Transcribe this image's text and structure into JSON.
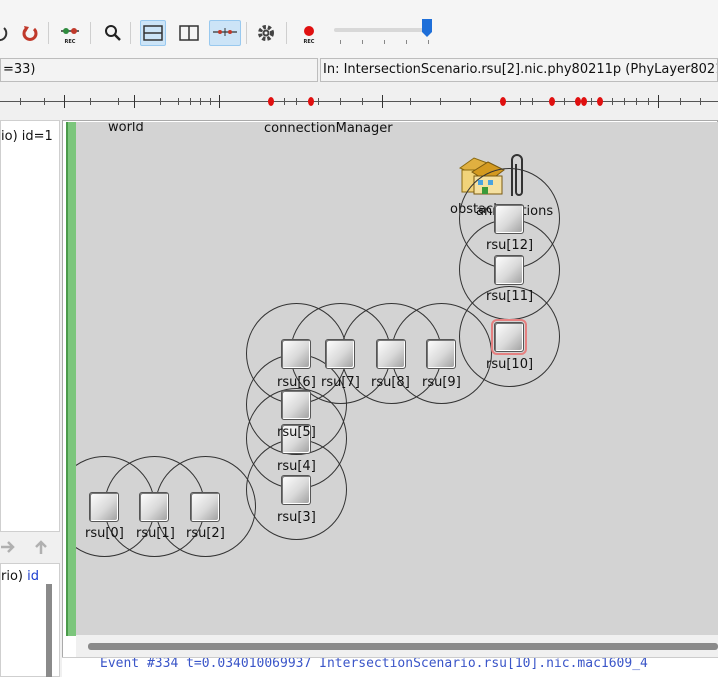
{
  "toolbar": {
    "buttons": [
      {
        "icon": "rebuild-network-icon"
      },
      {
        "icon": "restart-icon"
      },
      {
        "icon": "record-network-icon",
        "label": "REC"
      },
      {
        "icon": "search-icon"
      },
      {
        "icon": "layout-horizontal-icon"
      },
      {
        "icon": "layout-vertical-icon"
      },
      {
        "icon": "timeline-icon"
      },
      {
        "icon": "gear-icon"
      },
      {
        "icon": "record-video-icon",
        "label": "REC"
      }
    ],
    "speed_slider": {
      "value": 0.9
    }
  },
  "status": {
    "left": "=33)",
    "right": "In: IntersectionScenario.rsu[2].nic.phy80211p (PhyLayer80211p"
  },
  "left_panel": {
    "top_text": "io) id=1",
    "bottom_text_prefix": "rio) ",
    "bottom_text_kw": "id"
  },
  "canvas": {
    "labels": {
      "world": "world",
      "connection_manager": "connectionManager",
      "obstacles": "obstacles",
      "annotations": "annotations"
    },
    "nodes": [
      {
        "name": "rsu[0]"
      },
      {
        "name": "rsu[1]"
      },
      {
        "name": "rsu[2]"
      },
      {
        "name": "rsu[3]"
      },
      {
        "name": "rsu[4]"
      },
      {
        "name": "rsu[5]"
      },
      {
        "name": "rsu[6]"
      },
      {
        "name": "rsu[7]"
      },
      {
        "name": "rsu[8]"
      },
      {
        "name": "rsu[9]"
      },
      {
        "name": "rsu[10]",
        "selected": true
      },
      {
        "name": "rsu[11]"
      },
      {
        "name": "rsu[12]"
      }
    ]
  },
  "log": {
    "line": "Event #334  t=0.034010069937  IntersectionScenario.rsu[10].nic.mac1609_4"
  },
  "colors": {
    "canvas_bg": "#d3d3d3",
    "event_dot": "#e01010",
    "selected_outline": "#e58080",
    "module_bar": "#7cc67c",
    "log_text": "#3a55c8"
  }
}
